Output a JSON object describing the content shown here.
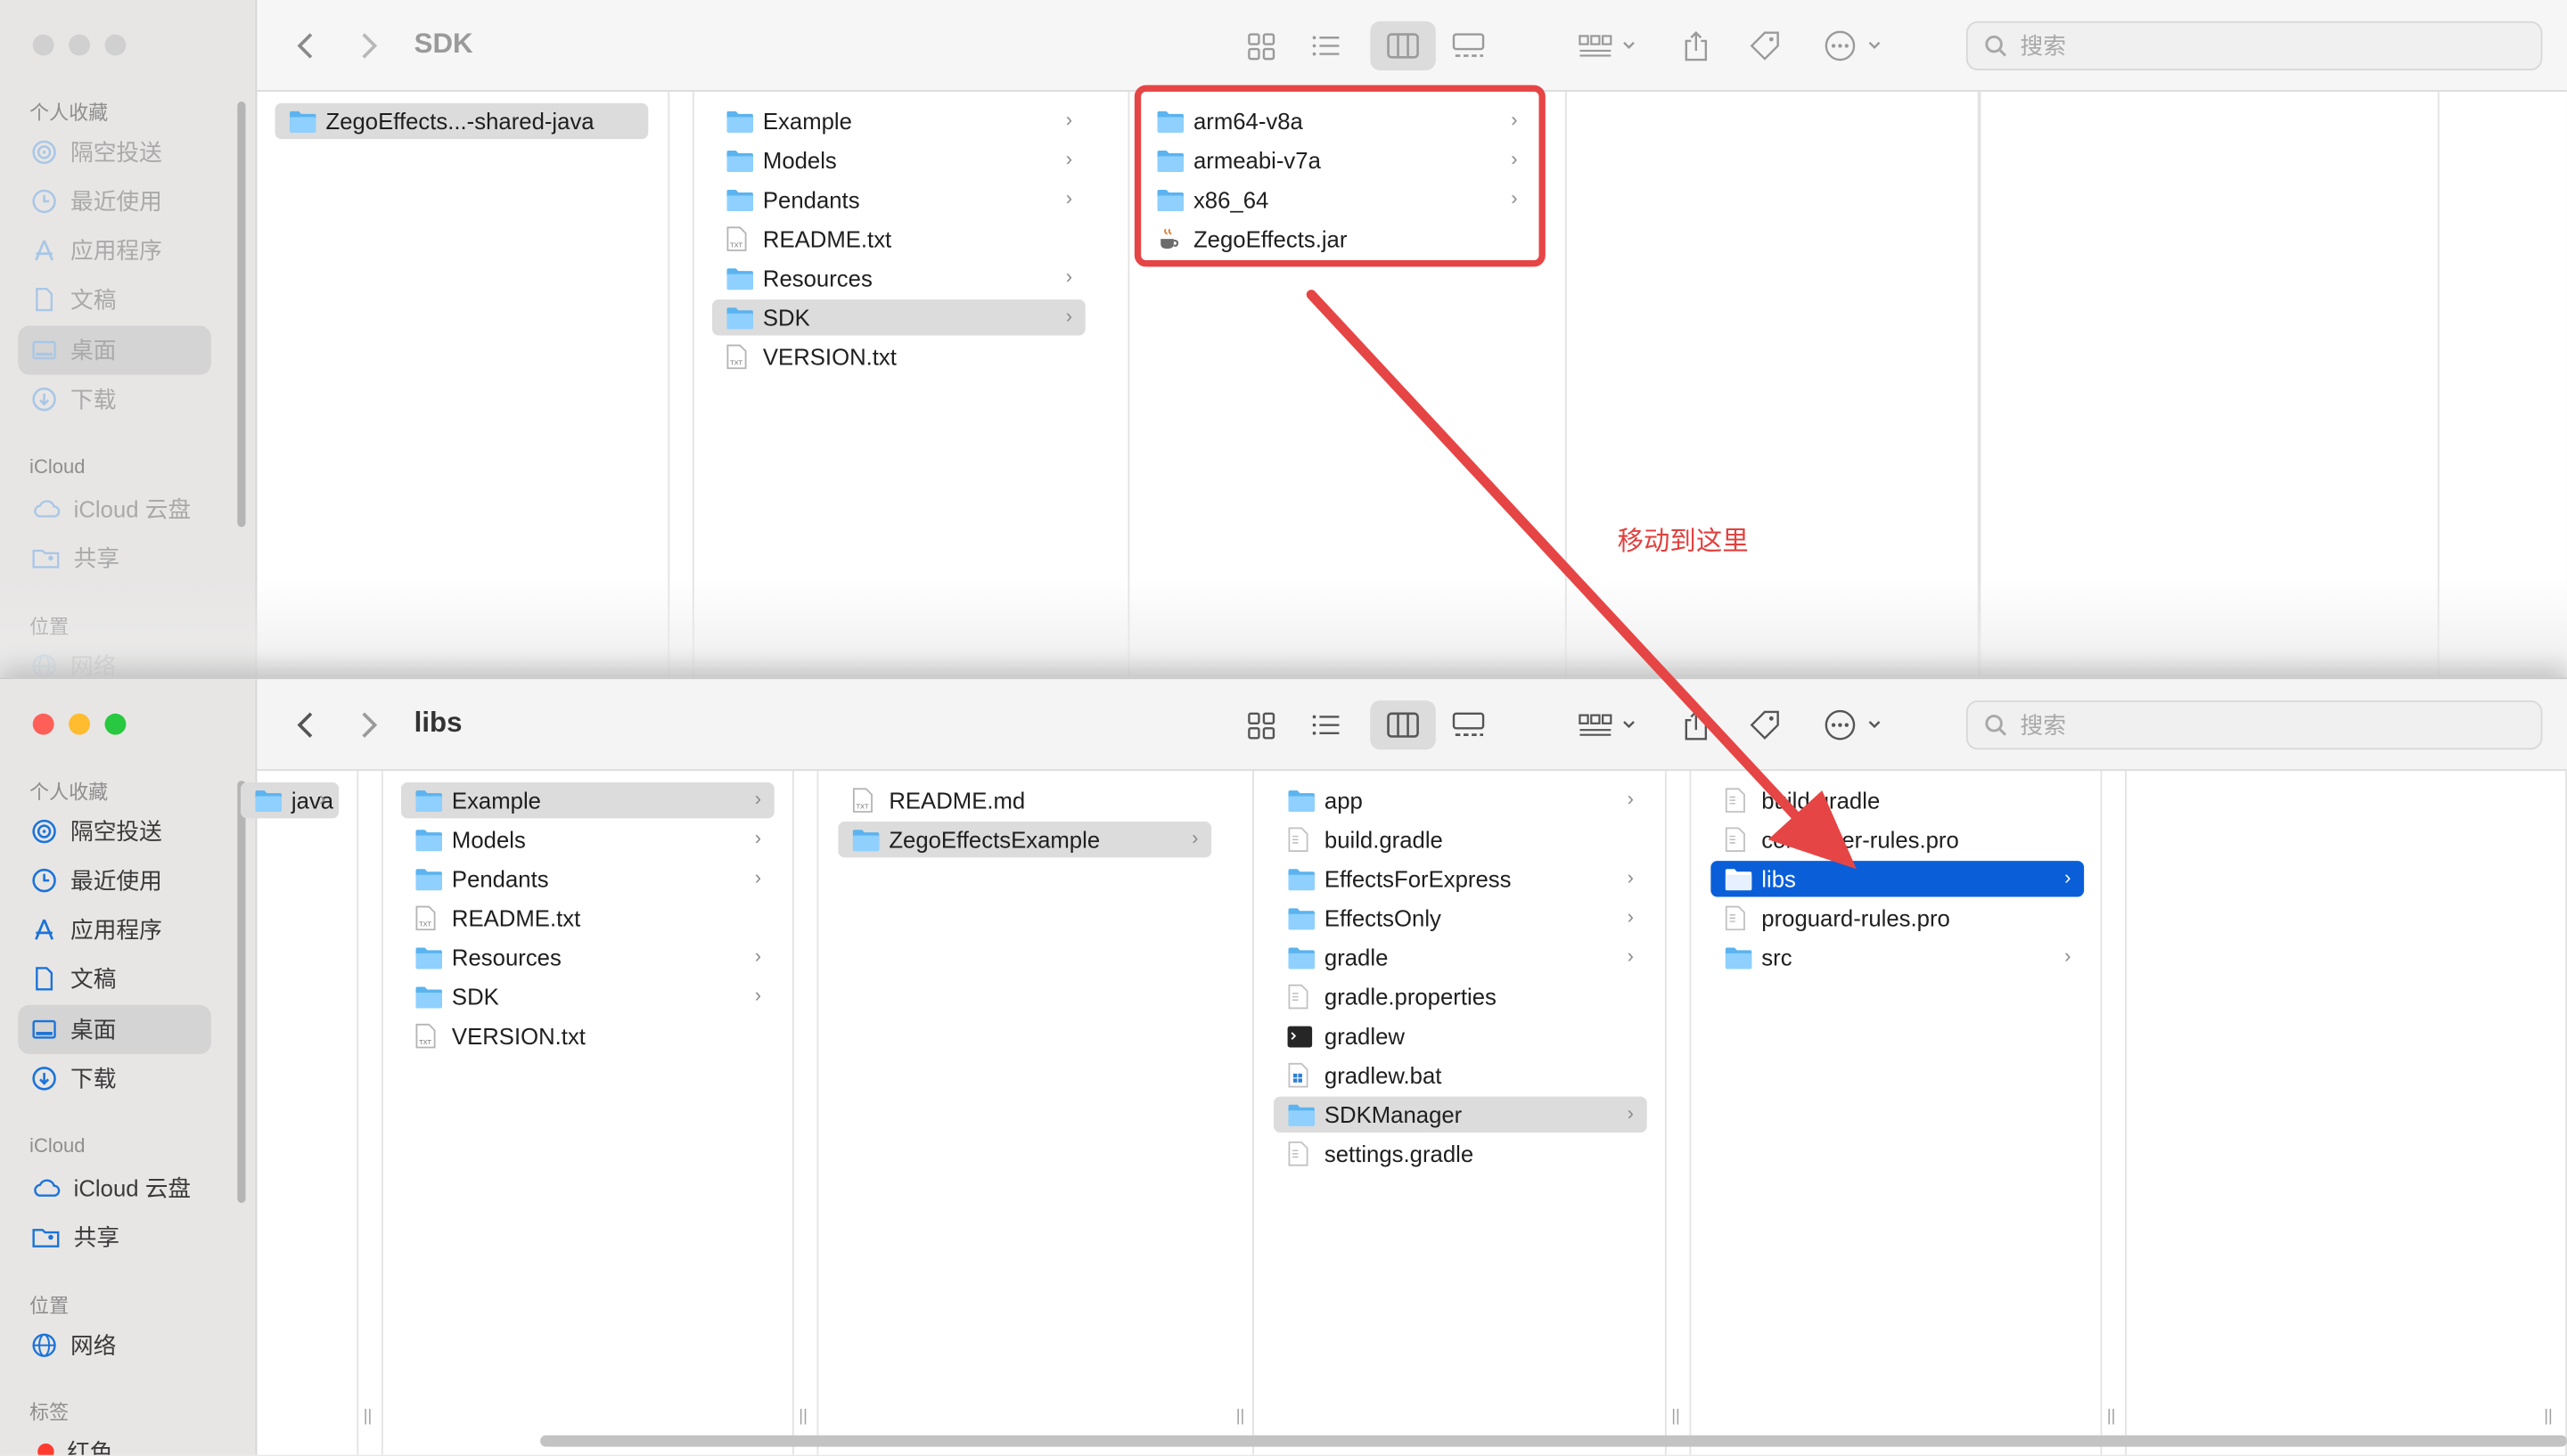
{
  "back_window": {
    "title": "SDK",
    "sidebar": {
      "favorites_header": "个人收藏",
      "items": [
        {
          "label": "隔空投送",
          "icon": "airdrop-icon"
        },
        {
          "label": "最近使用",
          "icon": "clock-icon"
        },
        {
          "label": "应用程序",
          "icon": "apps-icon"
        },
        {
          "label": "文稿",
          "icon": "document-icon"
        },
        {
          "label": "桌面",
          "icon": "desktop-icon",
          "selected": true
        },
        {
          "label": "下载",
          "icon": "download-icon"
        }
      ],
      "icloud_header": "iCloud",
      "icloud_items": [
        {
          "label": "iCloud 云盘",
          "icon": "cloud-icon"
        },
        {
          "label": "共享",
          "icon": "shared-folder-icon"
        }
      ],
      "locations_header": "位置",
      "location_items": [
        {
          "label": "网络",
          "icon": "network-icon"
        }
      ]
    },
    "search_placeholder": "搜索",
    "col1": [
      {
        "name": "ZegoEffects...-shared-java",
        "type": "folder",
        "selected": true
      }
    ],
    "col2": [
      {
        "name": "Example",
        "type": "folder",
        "chevron": true
      },
      {
        "name": "Models",
        "type": "folder",
        "chevron": true
      },
      {
        "name": "Pendants",
        "type": "folder",
        "chevron": true
      },
      {
        "name": "README.txt",
        "type": "txt"
      },
      {
        "name": "Resources",
        "type": "folder",
        "chevron": true
      },
      {
        "name": "SDK",
        "type": "folder",
        "chevron": true,
        "selected": true
      },
      {
        "name": "VERSION.txt",
        "type": "txt"
      }
    ],
    "col3": [
      {
        "name": "arm64-v8a",
        "type": "folder",
        "chevron": true
      },
      {
        "name": "armeabi-v7a",
        "type": "folder",
        "chevron": true
      },
      {
        "name": "x86_64",
        "type": "folder",
        "chevron": true
      },
      {
        "name": "ZegoEffects.jar",
        "type": "jar"
      }
    ]
  },
  "front_window": {
    "title": "libs",
    "sidebar": {
      "favorites_header": "个人收藏",
      "items": [
        {
          "label": "隔空投送",
          "icon": "airdrop-icon"
        },
        {
          "label": "最近使用",
          "icon": "clock-icon"
        },
        {
          "label": "应用程序",
          "icon": "apps-icon"
        },
        {
          "label": "文稿",
          "icon": "document-icon"
        },
        {
          "label": "桌面",
          "icon": "desktop-icon",
          "selected": true
        },
        {
          "label": "下载",
          "icon": "download-icon"
        }
      ],
      "icloud_header": "iCloud",
      "icloud_items": [
        {
          "label": "iCloud 云盘",
          "icon": "cloud-icon"
        },
        {
          "label": "共享",
          "icon": "shared-folder-icon"
        }
      ],
      "locations_header": "位置",
      "location_items": [
        {
          "label": "网络",
          "icon": "network-icon"
        }
      ],
      "tags_header": "标签",
      "tag_items": [
        {
          "label": "红色",
          "color": "#ff3b30"
        }
      ]
    },
    "search_placeholder": "搜索",
    "col0": [
      {
        "name": "java",
        "type": "folder",
        "chevron": true,
        "selected": true
      }
    ],
    "col1": [
      {
        "name": "Example",
        "type": "folder",
        "chevron": true,
        "selected": true
      },
      {
        "name": "Models",
        "type": "folder",
        "chevron": true
      },
      {
        "name": "Pendants",
        "type": "folder",
        "chevron": true
      },
      {
        "name": "README.txt",
        "type": "txt"
      },
      {
        "name": "Resources",
        "type": "folder",
        "chevron": true
      },
      {
        "name": "SDK",
        "type": "folder",
        "chevron": true
      },
      {
        "name": "VERSION.txt",
        "type": "txt"
      }
    ],
    "col2": [
      {
        "name": "README.md",
        "type": "txt"
      },
      {
        "name": "ZegoEffectsExample",
        "type": "folder",
        "chevron": true,
        "selected": true
      }
    ],
    "col3": [
      {
        "name": "app",
        "type": "folder",
        "chevron": true
      },
      {
        "name": "build.gradle",
        "type": "doc"
      },
      {
        "name": "EffectsForExpress",
        "type": "folder",
        "chevron": true
      },
      {
        "name": "EffectsOnly",
        "type": "folder",
        "chevron": true
      },
      {
        "name": "gradle",
        "type": "folder",
        "chevron": true
      },
      {
        "name": "gradle.properties",
        "type": "doc"
      },
      {
        "name": "gradlew",
        "type": "exec"
      },
      {
        "name": "gradlew.bat",
        "type": "bat"
      },
      {
        "name": "SDKManager",
        "type": "folder",
        "chevron": true,
        "selected": true
      },
      {
        "name": "settings.gradle",
        "type": "doc"
      }
    ],
    "col4": [
      {
        "name": "build.gradle",
        "type": "doc"
      },
      {
        "name": "consumer-rules.pro",
        "type": "doc"
      },
      {
        "name": "libs",
        "type": "folder",
        "chevron": true,
        "active": true
      },
      {
        "name": "proguard-rules.pro",
        "type": "doc"
      },
      {
        "name": "src",
        "type": "folder",
        "chevron": true
      }
    ]
  },
  "annotation": {
    "text": "移动到这里",
    "color": "#e0413e"
  }
}
